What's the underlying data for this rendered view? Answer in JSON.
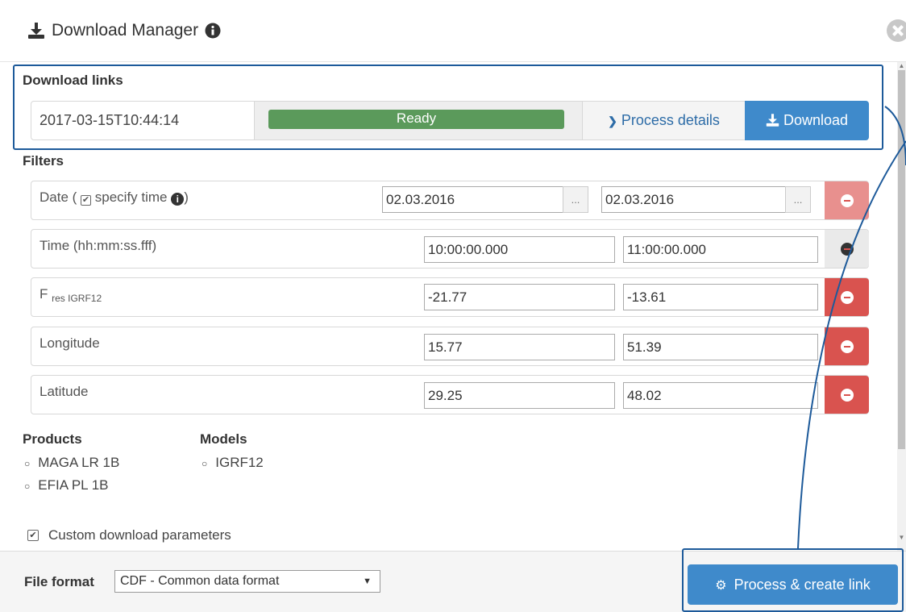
{
  "header": {
    "title": "Download Manager"
  },
  "download_links": {
    "section_title": "Download links",
    "timestamp": "2017-03-15T10:44:14",
    "status": "Ready",
    "details_label": "Process details",
    "download_label": "Download"
  },
  "filters": {
    "section_title": "Filters",
    "date": {
      "label_prefix": "Date (",
      "label_suffix": "specify time",
      "label_close": ")",
      "from": "02.03.2016",
      "to": "02.03.2016",
      "cal_label": "..."
    },
    "time": {
      "label": "Time (hh:mm:ss.fff)",
      "from": "10:00:00.000",
      "to": "11:00:00.000"
    },
    "fres": {
      "label_main": "F",
      "label_sub": "res IGRF12",
      "from": "-21.77",
      "to": "-13.61"
    },
    "longitude": {
      "label": "Longitude",
      "from": "15.77",
      "to": "51.39"
    },
    "latitude": {
      "label": "Latitude",
      "from": "29.25",
      "to": "48.02"
    }
  },
  "products": {
    "title": "Products",
    "items": [
      "MAGA LR 1B",
      "EFIA PL 1B"
    ]
  },
  "models": {
    "title": "Models",
    "items": [
      "IGRF12"
    ]
  },
  "custom_params": {
    "label": "Custom download parameters",
    "checked": true
  },
  "footer": {
    "file_format_label": "File format",
    "file_format_value": "CDF - Common data format",
    "process_label": "Process & create link"
  },
  "colors": {
    "primary": "#3f8acb",
    "danger": "#d9534f",
    "success": "#5b9a5b",
    "callout": "#1d5a9a"
  }
}
